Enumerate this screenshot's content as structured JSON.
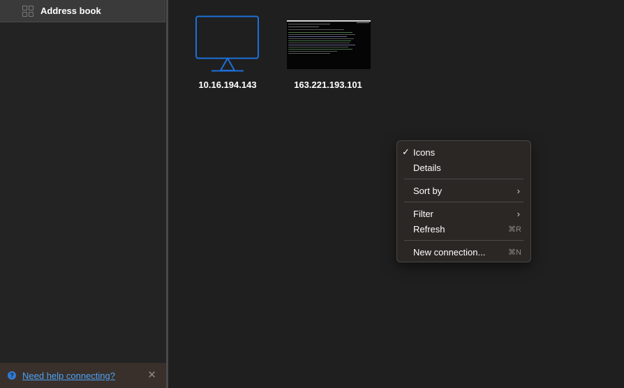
{
  "sidebar": {
    "items": [
      {
        "label": "Address book",
        "icon": "grid-icon"
      }
    ]
  },
  "help": {
    "link_text": "Need help connecting?",
    "icon": "help-icon",
    "close_glyph": "✕"
  },
  "connections": [
    {
      "name": "10.16.194.143",
      "thumbnail": "monitor-icon"
    },
    {
      "name": "163.221.193.101",
      "thumbnail": "screenshot"
    }
  ],
  "context_menu": {
    "items": [
      {
        "label": "Icons",
        "checked": true
      },
      {
        "label": "Details"
      },
      {
        "label": "Sort by",
        "submenu": true
      },
      {
        "label": "Filter",
        "submenu": true
      },
      {
        "label": "Refresh",
        "shortcut": "⌘R"
      },
      {
        "label": "New connection...",
        "shortcut": "⌘N"
      }
    ],
    "check_glyph": "✓",
    "chevron_glyph": "›"
  },
  "colors": {
    "accent_blue": "#1e6fd9",
    "link_blue": "#4ba3f5",
    "background": "#1f1f1f"
  }
}
